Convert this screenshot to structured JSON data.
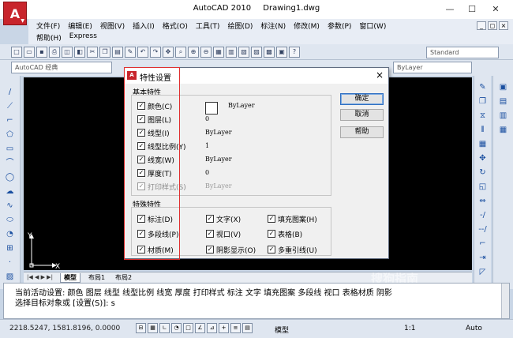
{
  "window": {
    "app_name": "AutoCAD 2010",
    "doc_name": "Drawing1.dwg",
    "logo_letter": "A",
    "minimize": "—",
    "maximize": "☐",
    "close": "✕"
  },
  "menu": {
    "row1": [
      "文件(F)",
      "编辑(E)",
      "视图(V)",
      "插入(I)",
      "格式(O)",
      "工具(T)",
      "绘图(D)",
      "标注(N)",
      "修改(M)",
      "参数(P)",
      "窗口(W)"
    ],
    "row2": [
      "帮助(H)",
      "Express"
    ],
    "mdi_buttons": [
      "_",
      "◻",
      "×"
    ]
  },
  "toolbars": {
    "workspace": "AutoCAD 经典",
    "textstyle": "Standard",
    "layer_color": "ByLayer"
  },
  "dialog": {
    "title": "特性设置",
    "close": "×",
    "basic_group": "基本特性",
    "basic": [
      {
        "label": "颜色(C)",
        "value": "ByLayer",
        "checked": true
      },
      {
        "label": "图层(L)",
        "value": "0",
        "checked": true
      },
      {
        "label": "线型(I)",
        "value": "ByLayer",
        "checked": true
      },
      {
        "label": "线型比例(Y)",
        "value": "1",
        "checked": true
      },
      {
        "label": "线宽(W)",
        "value": "ByLayer",
        "checked": true
      },
      {
        "label": "厚度(T)",
        "value": "0",
        "checked": true
      },
      {
        "label": "打印样式(S)",
        "value": "ByLayer",
        "checked": true,
        "disabled": true
      }
    ],
    "special_group": "特殊特性",
    "special": [
      [
        "标注(D)",
        "文字(X)",
        "填充图案(H)"
      ],
      [
        "多段线(P)",
        "视口(V)",
        "表格(B)"
      ],
      [
        "材质(M)",
        "阴影显示(O)",
        "多重引线(U)"
      ]
    ],
    "buttons": {
      "ok": "确定",
      "cancel": "取消",
      "help": "帮助"
    },
    "check": "✓"
  },
  "layout_tabs": {
    "nav": "|◀ ◀ ▶ ▶|",
    "tabs": [
      "模型",
      "布局1",
      "布局2"
    ]
  },
  "ucs": {
    "y": "Y",
    "x": "X"
  },
  "command": {
    "line1": "当前活动设置: 颜色 图层 线型 线型比例 线宽 厚度 打印样式 标注 文字 填充图案 多段线 视口 表格材质 阴影",
    "line2": "选择目标对象或 [设置(S)]: s"
  },
  "status": {
    "coords": "2218.5247,  1581.8196, 0.0000",
    "model": "模型",
    "scale": "1:1",
    "auto": "Auto"
  },
  "watermark": "搜狗指南"
}
